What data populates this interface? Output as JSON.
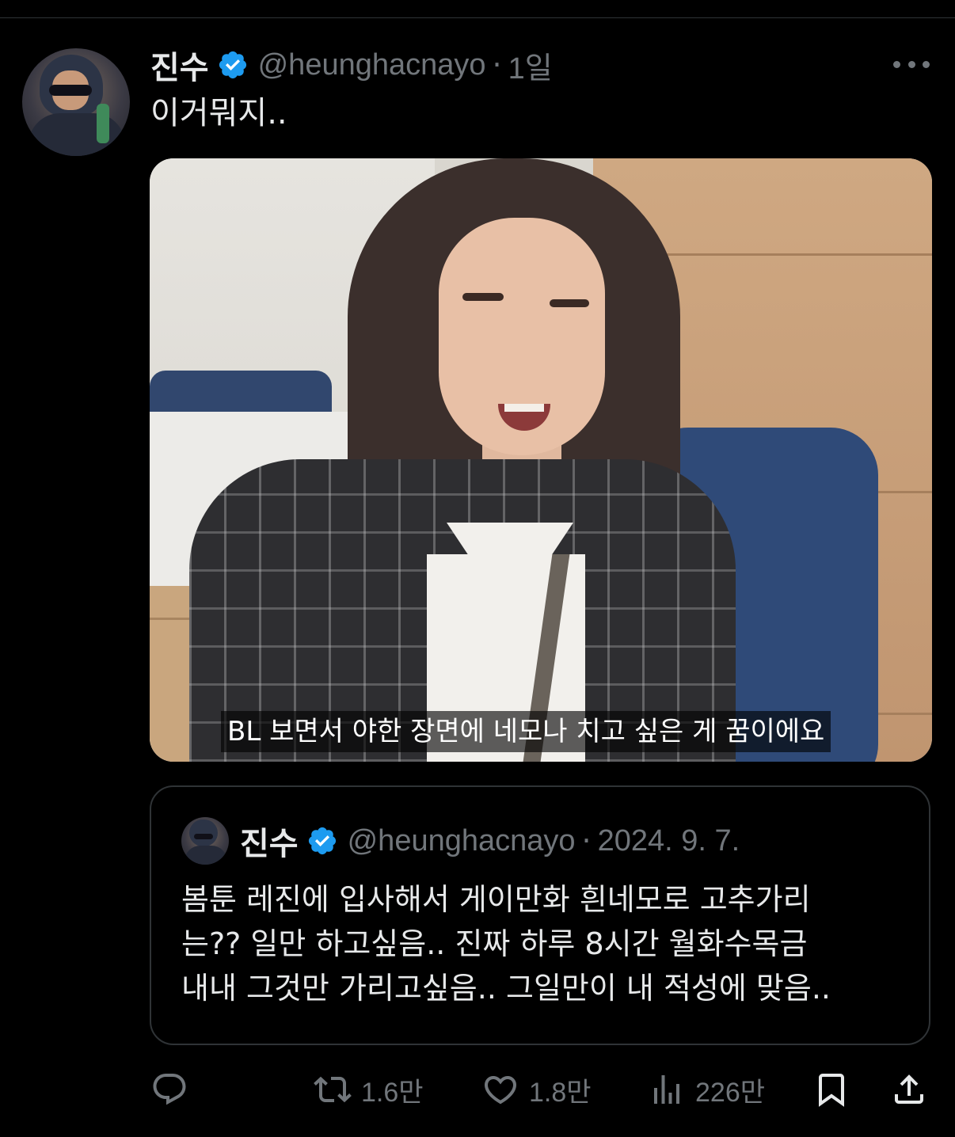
{
  "colors": {
    "background": "#000000",
    "text_primary": "#e7e9ea",
    "text_secondary": "#71767b",
    "verified_blue": "#1d9bf0",
    "border": "#2f3336"
  },
  "tweet": {
    "author_name": "진수",
    "verified_icon": "verified-badge-icon",
    "handle": "@heunghacnayo",
    "separator": "·",
    "time": "1일",
    "more_icon": "more-options-icon",
    "text": "이거뭐지..",
    "media": {
      "caption": "BL 보면서 야한 장면에 네모나 치고 싶은 게 꿈이에요"
    }
  },
  "quoted_tweet": {
    "author_name": "진수",
    "handle": "@heunghacnayo",
    "separator": "·",
    "date": "2024. 9. 7.",
    "lines": [
      "봄툰 레진에 입사해서 게이만화 흰네모로 고추가리",
      "는?? 일만 하고싶음.. 진짜 하루 8시간 월화수목금",
      "내내 그것만 가리고싶음.. 그일만이 내 적성에 맞음.."
    ]
  },
  "actions": {
    "reply": {
      "icon": "reply-icon",
      "count": ""
    },
    "retweet": {
      "icon": "retweet-icon",
      "count": "1.6만"
    },
    "like": {
      "icon": "heart-icon",
      "count": "1.8만"
    },
    "views": {
      "icon": "views-icon",
      "count": "226만"
    },
    "bookmark": {
      "icon": "bookmark-icon"
    },
    "share": {
      "icon": "share-icon"
    }
  }
}
